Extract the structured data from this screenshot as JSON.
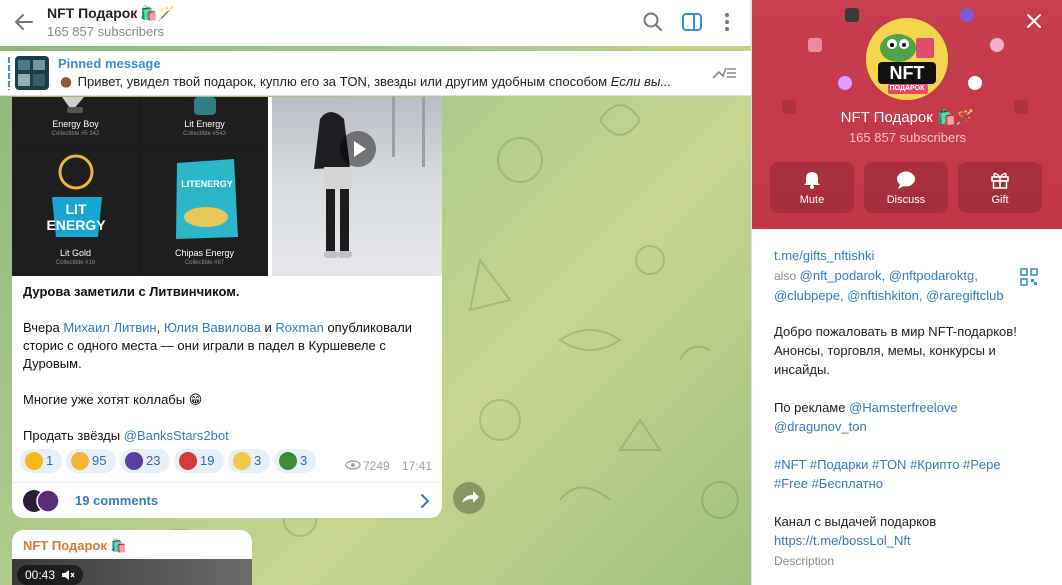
{
  "header": {
    "title": "NFT Подарок",
    "title_emoji": "🛍️🪄",
    "subscribers": "165 857 subscribers"
  },
  "pinned": {
    "label": "Pinned message",
    "text": "Привет, увидел твой подарок, куплю его за TON, звезды или другим удобным способом",
    "text_italic": "Если вы..."
  },
  "post": {
    "grid": [
      {
        "name": "Energy Boy",
        "sub": "Collectible #5 342"
      },
      {
        "name": "Lit Energy",
        "sub": "Collectible #543"
      },
      {
        "name": "Lit Gold",
        "sub": "Collectible #16"
      },
      {
        "name": "Chipas Energy",
        "sub": "Collectible #97"
      }
    ],
    "grid_art_text": [
      "LIT ENERGY",
      "LITENERGY"
    ],
    "title": "Дурова заметили с Литвинчиком.",
    "p1_prefix": "Вчера",
    "p1_link1": "Михаил Литвин",
    "p1_sep1": ",",
    "p1_link2": "Юлия Вавилова",
    "p1_sep2": "и",
    "p1_link3": "Roxman",
    "p1_suffix": "опубликовали сторис с одного места — они играли в падел в Куршевеле с Дуровым.",
    "p2": "Многие уже хотят коллабы",
    "p2_emoji": "😁",
    "p3_prefix": "Продать звёзды",
    "p3_link": "@BanksStars2bot",
    "reactions": [
      {
        "emoji": "⭐",
        "count": "1",
        "color": "#f6b81a"
      },
      {
        "emoji": "😍",
        "count": "95",
        "color": "#f2b53a"
      },
      {
        "emoji": "🧙",
        "count": "23",
        "color": "#5a3fa2"
      },
      {
        "emoji": "🎅",
        "count": "19",
        "color": "#d73a3a"
      },
      {
        "emoji": "🤯",
        "count": "3",
        "color": "#f0c84a"
      },
      {
        "emoji": "🐸",
        "count": "3",
        "color": "#3c8a3a"
      }
    ],
    "views": "7249",
    "time": "17:41",
    "comments": "19 comments"
  },
  "post2": {
    "author": "NFT Подарок",
    "author_emoji": "🛍️",
    "duration": "00:43"
  },
  "side": {
    "title": "NFT Подарок",
    "title_emoji": "🛍️🪄",
    "subscribers": "165 857 subscribers",
    "avatar_text": "NFT",
    "avatar_subtext": "ПОДАРОК",
    "buttons": {
      "mute": "Mute",
      "discuss": "Discuss",
      "gift": "Gift"
    },
    "link": "t.me/gifts_nftishki",
    "also_label": "also",
    "also_links": "@nft_podarok, @nftpodaroktg, @clubpepe, @nftishkiton, @raregiftclub",
    "welcome": "Добро пожаловать в мир NFT-подарков! Анонсы, торговля, мемы, конкурсы и инсайды.",
    "ads_label": "По рекламе",
    "ads_link1": "@Hamsterfreelove",
    "ads_link2": "@dragunov_ton",
    "hashtags1": "#NFT #Подарки #TON #Крипто #Pepe",
    "hashtags2": "#Free #Бесплатно",
    "channel_label": "Канал с выдачей подарков",
    "channel_link": "https://t.me/bossLol_Nft",
    "description_label": "Description"
  },
  "colors": {
    "accent_link": "#2f7ec2",
    "side_header": "#c93e4f",
    "author_orange": "#d9793a"
  }
}
